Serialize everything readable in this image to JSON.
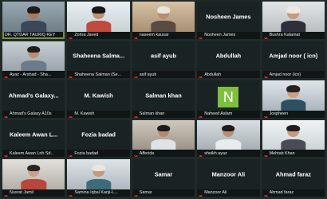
{
  "colors": {
    "background": "#121a1a",
    "tile": "#1a2323",
    "active_border": "#c9d94a",
    "muted": "#e0242a",
    "avatar": "#7fbf3f"
  },
  "participants": [
    {
      "label": "DR. QTDAR TAURIQ KEY",
      "video": true,
      "active": true
    },
    {
      "label": "Zohra Javed",
      "video": true,
      "muted": true
    },
    {
      "label": "naseem kausar",
      "video": true,
      "muted": true
    },
    {
      "label": "Nosheen James",
      "name": "Nosheen James",
      "muted": true
    },
    {
      "label": "Bushra Kalamat",
      "video": true,
      "muted": true
    },
    {
      "label": "Ayaz - Arshad - Sha...",
      "video": true,
      "muted": true
    },
    {
      "label": "Shaheena Salman (Se...",
      "name": "Shaheena Salma...",
      "muted": true
    },
    {
      "label": "asif ayub",
      "name": "asif ayub",
      "muted": true
    },
    {
      "label": "Abdullah",
      "name": "Abdullah",
      "muted": true
    },
    {
      "label": "Amjad noor (icn)",
      "name": "Amjad noor ( icn)",
      "muted": true
    },
    {
      "label": "Ahmad's Galaxy A10s",
      "name": "Ahmad's Galaxy...",
      "muted": true
    },
    {
      "label": "M. Kawish",
      "name": "M. Kawish",
      "muted": true
    },
    {
      "label": "Salman khan",
      "name": "Salman khan",
      "muted": true
    },
    {
      "label": "Naheed Aslam",
      "avatar": "N",
      "muted": true
    },
    {
      "label": "Jospheen",
      "video": true,
      "muted": true
    },
    {
      "label": "Kaleem Awan Lnh Sd...",
      "name": "Kaleem Awan L...",
      "muted": true
    },
    {
      "label": "Fozia badad",
      "name": "Fozia badad",
      "muted": true
    },
    {
      "label": "Afferida",
      "video": true,
      "muted": true
    },
    {
      "label": "sheikh ayaz",
      "video": true,
      "muted": true
    },
    {
      "label": "Mehtab Khan",
      "video": true,
      "muted": true
    },
    {
      "label": "Nusrat Jamil",
      "video": true,
      "muted": true
    },
    {
      "label": "Samina Iqbal Kanji-L...",
      "video": true,
      "muted": true
    },
    {
      "label": "Samar",
      "name": "Samar",
      "muted": true
    },
    {
      "label": "Manzoor Ali",
      "name": "Manzoor Ali",
      "muted": true
    },
    {
      "label": "Ahmad faraz",
      "name": "Ahmad faraz",
      "muted": true
    }
  ]
}
